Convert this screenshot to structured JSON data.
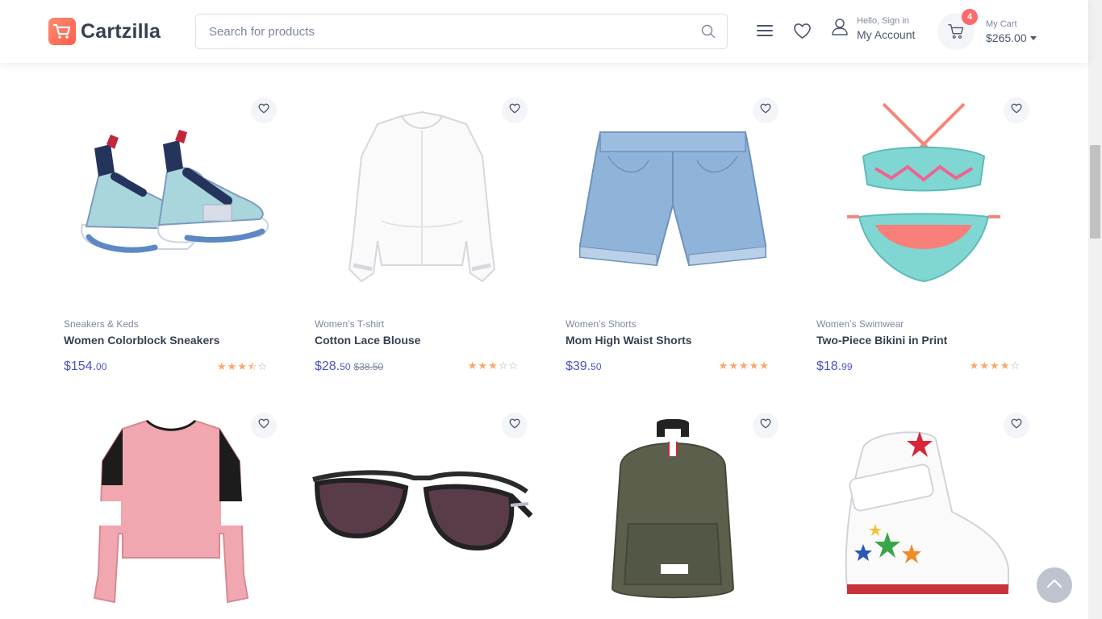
{
  "header": {
    "brand": "Cartzilla",
    "search_placeholder": "Search for products",
    "account_greeting": "Hello, Sign in",
    "account_label": "My Account",
    "cart_count": "4",
    "cart_label": "My Cart",
    "cart_total": "$265.00"
  },
  "colors": {
    "accent": "#fe696a",
    "price": "#4e54c8",
    "star": "#fea569"
  },
  "products": [
    {
      "category": "Sneakers & Keds",
      "title": "Women Colorblock Sneakers",
      "price_main": "$154.",
      "price_cents": "00",
      "old_price": "",
      "rating": 3.5
    },
    {
      "category": "Women’s T-shirt",
      "title": "Cotton Lace Blouse",
      "price_main": "$28.",
      "price_cents": "50",
      "old_price": "$38.50",
      "rating": 3
    },
    {
      "category": "Women’s Shorts",
      "title": "Mom High Waist Shorts",
      "price_main": "$39.",
      "price_cents": "50",
      "old_price": "",
      "rating": 5
    },
    {
      "category": "Women’s Swimwear",
      "title": "Two-Piece Bikini in Print",
      "price_main": "$18.",
      "price_cents": "99",
      "old_price": "",
      "rating": 4
    },
    {
      "category": "",
      "title": "",
      "price_main": "",
      "price_cents": "",
      "old_price": "",
      "rating": 0
    },
    {
      "category": "",
      "title": "",
      "price_main": "",
      "price_cents": "",
      "old_price": "",
      "rating": 0
    },
    {
      "category": "",
      "title": "",
      "price_main": "",
      "price_cents": "",
      "old_price": "",
      "rating": 0
    },
    {
      "category": "",
      "title": "",
      "price_main": "",
      "price_cents": "",
      "old_price": "",
      "rating": 0
    }
  ],
  "icons": [
    "search-icon",
    "menu-icon",
    "heart-icon",
    "user-icon",
    "cart-icon",
    "chevron-up-icon"
  ]
}
